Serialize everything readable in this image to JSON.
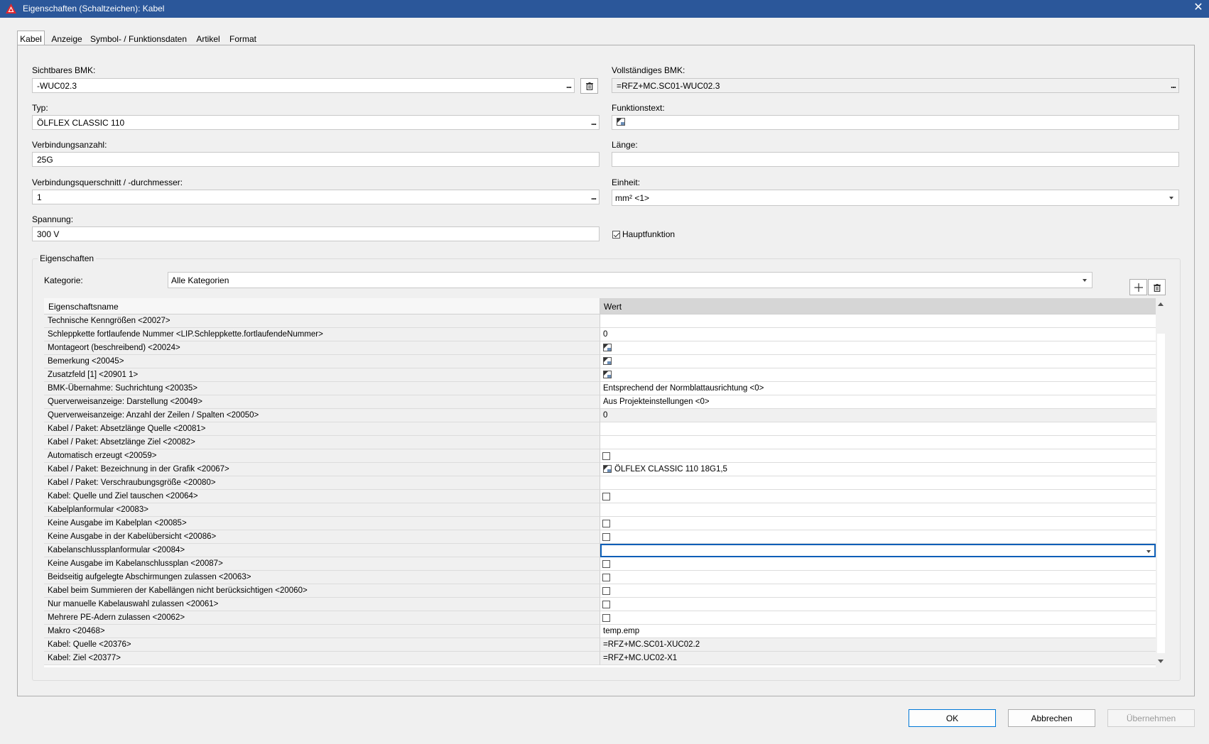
{
  "window": {
    "title": "Eigenschaften (Schaltzeichen): Kabel",
    "close_glyph": "✕"
  },
  "tabs": [
    "Kabel",
    "Anzeige",
    "Symbol- / Funktionsdaten",
    "Artikel",
    "Format"
  ],
  "form": {
    "sichtbares_bmk_label": "Sichtbares BMK:",
    "sichtbares_bmk_value": "-WUC02.3",
    "vollstaendiges_bmk_label": "Vollständiges BMK:",
    "vollstaendiges_bmk_value": "=RFZ+MC.SC01-WUC02.3",
    "typ_label": "Typ:",
    "typ_value": "ÖLFLEX CLASSIC 110",
    "funktionstext_label": "Funktionstext:",
    "verbindungsanzahl_label": "Verbindungsanzahl:",
    "verbindungsanzahl_value": "25G",
    "laenge_label": "Länge:",
    "querschnitt_label": "Verbindungsquerschnitt / -durchmesser:",
    "querschnitt_value": "1",
    "einheit_label": "Einheit:",
    "einheit_value": "mm² <1>",
    "spannung_label": "Spannung:",
    "spannung_value": "300 V",
    "hauptfunktion_label": "Hauptfunktion",
    "hauptfunktion_checked": true,
    "dots": "..."
  },
  "properties": {
    "group_label": "Eigenschaften",
    "kategorie_label": "Kategorie:",
    "kategorie_value": "Alle Kategorien",
    "col_name": "Eigenschaftsname",
    "col_value": "Wert",
    "rows": [
      {
        "name": "Technische Kenngrößen <20027>",
        "type": "text",
        "value": ""
      },
      {
        "name": "Schleppkette fortlaufende Nummer <LIP.Schleppkette.fortlaufendeNummer>",
        "type": "text",
        "value": "0"
      },
      {
        "name": "Montageort (beschreibend) <20024>",
        "type": "icon",
        "value": ""
      },
      {
        "name": "Bemerkung <20045>",
        "type": "icon",
        "value": ""
      },
      {
        "name": "Zusatzfeld [1] <20901 1>",
        "type": "icon",
        "value": ""
      },
      {
        "name": "BMK-Übernahme: Suchrichtung <20035>",
        "type": "text",
        "value": "Entsprechend der Normblattausrichtung <0>"
      },
      {
        "name": "Querverweisanzeige: Darstellung <20049>",
        "type": "text",
        "value": "Aus Projekteinstellungen <0>"
      },
      {
        "name": "Querverweisanzeige: Anzahl der Zeilen / Spalten <20050>",
        "type": "text",
        "value": "0",
        "alt": true
      },
      {
        "name": "Kabel / Paket: Absetzlänge Quelle <20081>",
        "type": "text",
        "value": ""
      },
      {
        "name": "Kabel / Paket: Absetzlänge Ziel <20082>",
        "type": "text",
        "value": ""
      },
      {
        "name": "Automatisch erzeugt <20059>",
        "type": "check",
        "value": ""
      },
      {
        "name": "Kabel / Paket: Bezeichnung in der Grafik <20067>",
        "type": "icon",
        "value": "ÖLFLEX CLASSIC 110 18G1,5"
      },
      {
        "name": "Kabel / Paket: Verschraubungsgröße <20080>",
        "type": "text",
        "value": ""
      },
      {
        "name": "Kabel: Quelle und Ziel tauschen <20064>",
        "type": "check",
        "value": ""
      },
      {
        "name": "Kabelplanformular <20083>",
        "type": "text",
        "value": ""
      },
      {
        "name": "Keine Ausgabe im Kabelplan <20085>",
        "type": "check",
        "value": ""
      },
      {
        "name": "Keine Ausgabe in der Kabelübersicht <20086>",
        "type": "check",
        "value": ""
      },
      {
        "name": "Kabelanschlussplanformular <20084>",
        "type": "select",
        "value": ""
      },
      {
        "name": "Keine Ausgabe im  Kabelanschlussplan <20087>",
        "type": "check",
        "value": ""
      },
      {
        "name": "Beidseitig aufgelegte Abschirmungen zulassen <20063>",
        "type": "check",
        "value": ""
      },
      {
        "name": "Kabel beim Summieren der Kabellängen nicht berücksichtigen <20060>",
        "type": "check",
        "value": ""
      },
      {
        "name": "Nur manuelle Kabelauswahl zulassen <20061>",
        "type": "check",
        "value": ""
      },
      {
        "name": "Mehrere PE-Adern zulassen <20062>",
        "type": "check",
        "value": ""
      },
      {
        "name": "Makro <20468>",
        "type": "text",
        "value": "temp.emp"
      },
      {
        "name": "Kabel: Quelle <20376>",
        "type": "text",
        "value": "=RFZ+MC.SC01-XUC02.2",
        "alt": true
      },
      {
        "name": "Kabel: Ziel <20377>",
        "type": "text",
        "value": "=RFZ+MC.UC02-X1",
        "alt": true
      }
    ]
  },
  "buttons": {
    "ok": "OK",
    "cancel": "Abbrechen",
    "apply": "Übernehmen"
  },
  "colors": {
    "titlebar": "#2b579a",
    "selection": "#0b5eb7",
    "app_icon": "#e3262c"
  }
}
